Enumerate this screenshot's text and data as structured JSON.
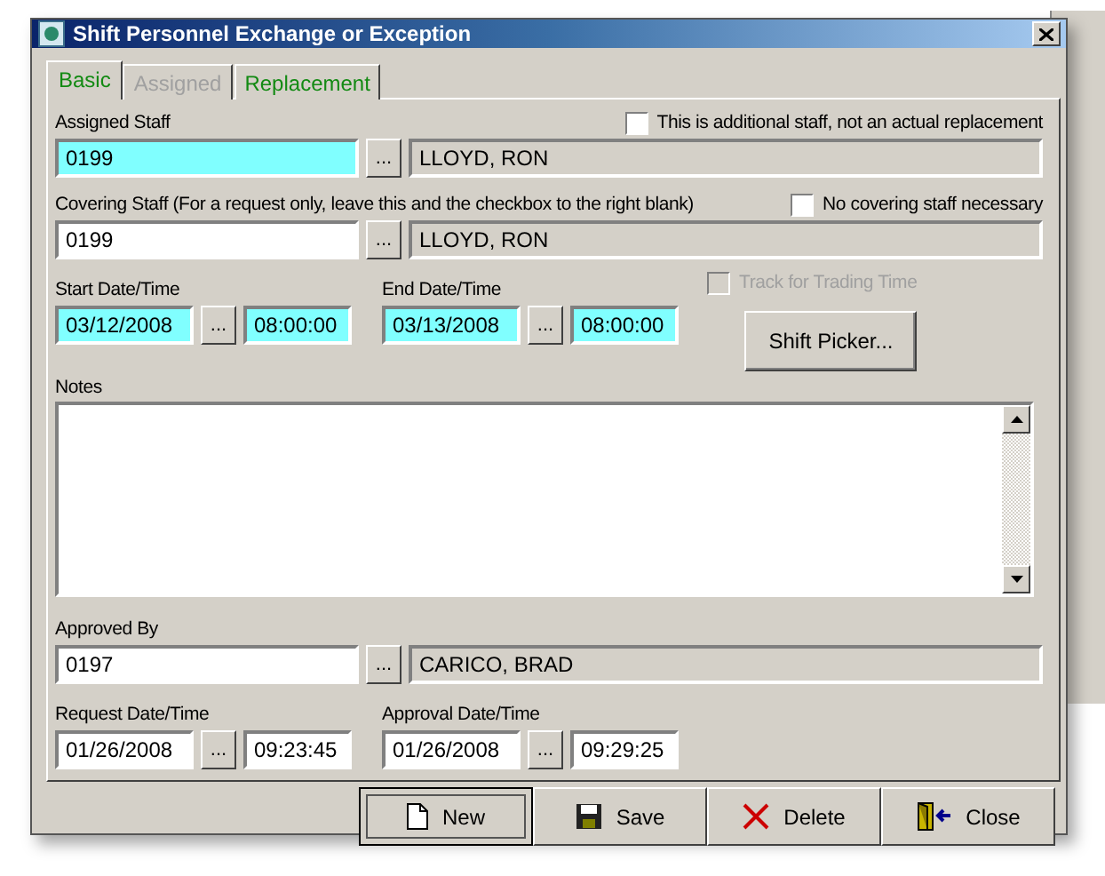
{
  "window": {
    "title": "Shift Personnel Exchange or Exception"
  },
  "tabs": [
    {
      "label": "Basic",
      "selected": true,
      "disabled": false
    },
    {
      "label": "Assigned",
      "selected": false,
      "disabled": true
    },
    {
      "label": "Replacement",
      "selected": false,
      "disabled": false
    }
  ],
  "assigned_staff": {
    "label": "Assigned Staff",
    "code": "0199",
    "highlighted": true,
    "name": "LLOYD, RON",
    "checkbox": {
      "label": "This is additional staff, not an actual replacement",
      "checked": false,
      "disabled": false
    }
  },
  "covering_staff": {
    "label": "Covering Staff (For a request only, leave this and the checkbox to the right blank)",
    "code": "0199",
    "highlighted": false,
    "name": "LLOYD, RON",
    "checkbox": {
      "label": "No covering staff necessary",
      "checked": false,
      "disabled": false
    }
  },
  "track_checkbox": {
    "label": "Track for Trading Time",
    "checked": false,
    "disabled": true
  },
  "start": {
    "label": "Start Date/Time",
    "date": "03/12/2008",
    "time": "08:00:00",
    "highlighted": true
  },
  "end": {
    "label": "End Date/Time",
    "date": "03/13/2008",
    "time": "08:00:00",
    "highlighted": true
  },
  "shift_picker": {
    "label": "Shift Picker..."
  },
  "notes": {
    "label": "Notes"
  },
  "approved_by": {
    "label": "Approved By",
    "code": "0197",
    "highlighted": false,
    "name": "CARICO, BRAD"
  },
  "request": {
    "label": "Request Date/Time",
    "date": "01/26/2008",
    "time": "09:23:45",
    "highlighted": false
  },
  "approval": {
    "label": "Approval Date/Time",
    "date": "01/26/2008",
    "time": "09:29:25",
    "highlighted": false
  },
  "lookup_button": "...",
  "buttons": [
    {
      "label": "New",
      "kind": "new",
      "default": true
    },
    {
      "label": "Save",
      "kind": "save",
      "default": false
    },
    {
      "label": "Delete",
      "kind": "delete",
      "default": false
    },
    {
      "label": "Close",
      "kind": "close",
      "default": false
    }
  ]
}
